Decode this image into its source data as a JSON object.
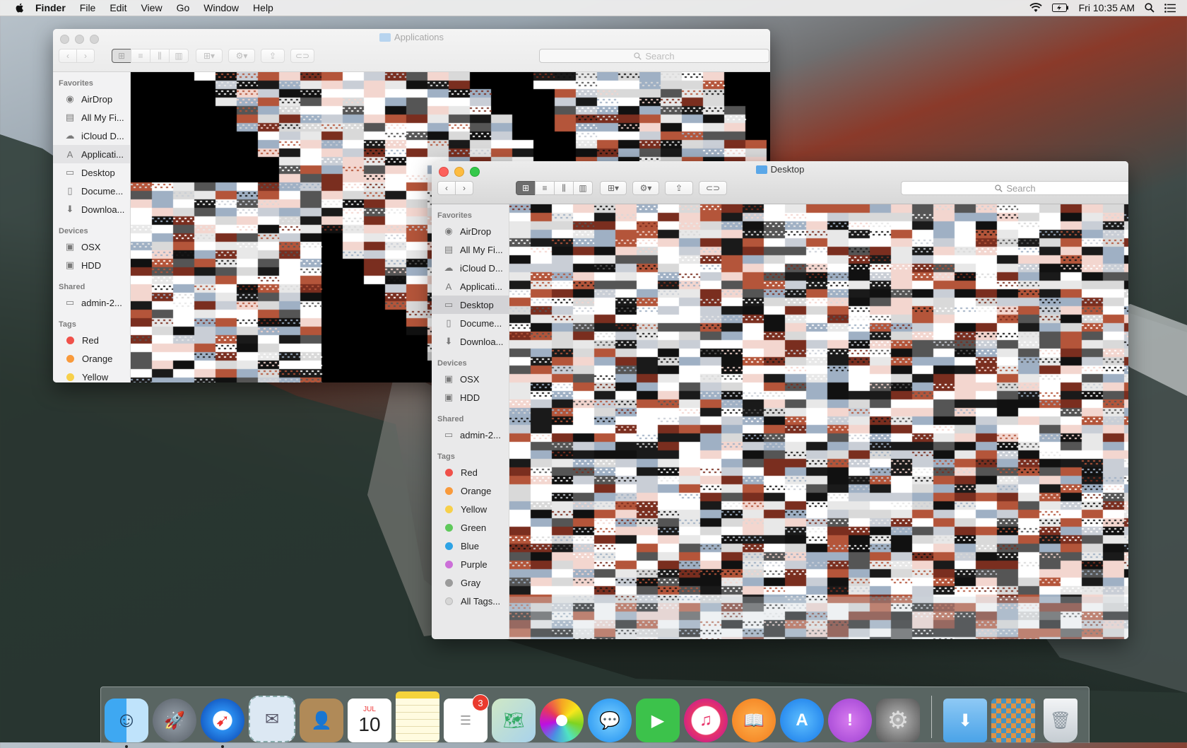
{
  "menubar": {
    "app_name": "Finder",
    "items": [
      "File",
      "Edit",
      "View",
      "Go",
      "Window",
      "Help"
    ],
    "clock": "Fri 10:35 AM",
    "icons": [
      "wifi-icon",
      "battery-icon",
      "spotlight-icon",
      "notification-center-icon"
    ]
  },
  "windows": {
    "applications": {
      "title": "Applications",
      "search_placeholder": "Search",
      "favorites_header": "Favorites",
      "favorites": [
        "AirDrop",
        "All My Fi...",
        "iCloud D...",
        "Applicati...",
        "Desktop",
        "Docume...",
        "Downloa..."
      ],
      "selected_favorite": "Applicati...",
      "devices_header": "Devices",
      "devices": [
        "OSX",
        "HDD"
      ],
      "shared_header": "Shared",
      "shared": [
        "admin-2..."
      ],
      "tags_header": "Tags",
      "tags": [
        "Red",
        "Orange",
        "Yellow"
      ]
    },
    "desktop": {
      "title": "Desktop",
      "search_placeholder": "Search",
      "favorites_header": "Favorites",
      "favorites": [
        "AirDrop",
        "All My Fi...",
        "iCloud D...",
        "Applicati...",
        "Desktop",
        "Docume...",
        "Downloa..."
      ],
      "selected_favorite": "Desktop",
      "devices_header": "Devices",
      "devices": [
        "OSX",
        "HDD"
      ],
      "shared_header": "Shared",
      "shared": [
        "admin-2..."
      ],
      "tags_header": "Tags",
      "tags": [
        "Red",
        "Orange",
        "Yellow",
        "Green",
        "Blue",
        "Purple",
        "Gray",
        "All Tags..."
      ]
    }
  },
  "tag_colors": {
    "Red": "#f0514a",
    "Orange": "#f99a3b",
    "Yellow": "#f7d04a",
    "Green": "#5fc95b",
    "Blue": "#2ea3e5",
    "Purple": "#cc6fd8",
    "Gray": "#9b9b9b",
    "All Tags...": "#d6d6d6"
  },
  "dock": {
    "items": [
      {
        "name": "finder",
        "running": true
      },
      {
        "name": "launchpad",
        "running": false
      },
      {
        "name": "safari",
        "running": true
      },
      {
        "name": "mail",
        "running": false
      },
      {
        "name": "contacts",
        "running": false
      },
      {
        "name": "calendar",
        "running": false,
        "month": "JUL",
        "day": "10"
      },
      {
        "name": "notes",
        "running": false
      },
      {
        "name": "reminders",
        "running": false,
        "badge": "3"
      },
      {
        "name": "maps",
        "running": false
      },
      {
        "name": "photos",
        "running": false
      },
      {
        "name": "messages",
        "running": false
      },
      {
        "name": "facetime",
        "running": false
      },
      {
        "name": "itunes",
        "running": false
      },
      {
        "name": "ibooks",
        "running": false
      },
      {
        "name": "app-store",
        "running": false
      },
      {
        "name": "feedback-assistant",
        "running": false
      },
      {
        "name": "system-preferences",
        "running": false
      },
      {
        "name": "downloads-stack",
        "running": false
      },
      {
        "name": "applications-stack",
        "running": false
      },
      {
        "name": "trash",
        "running": false
      }
    ]
  }
}
